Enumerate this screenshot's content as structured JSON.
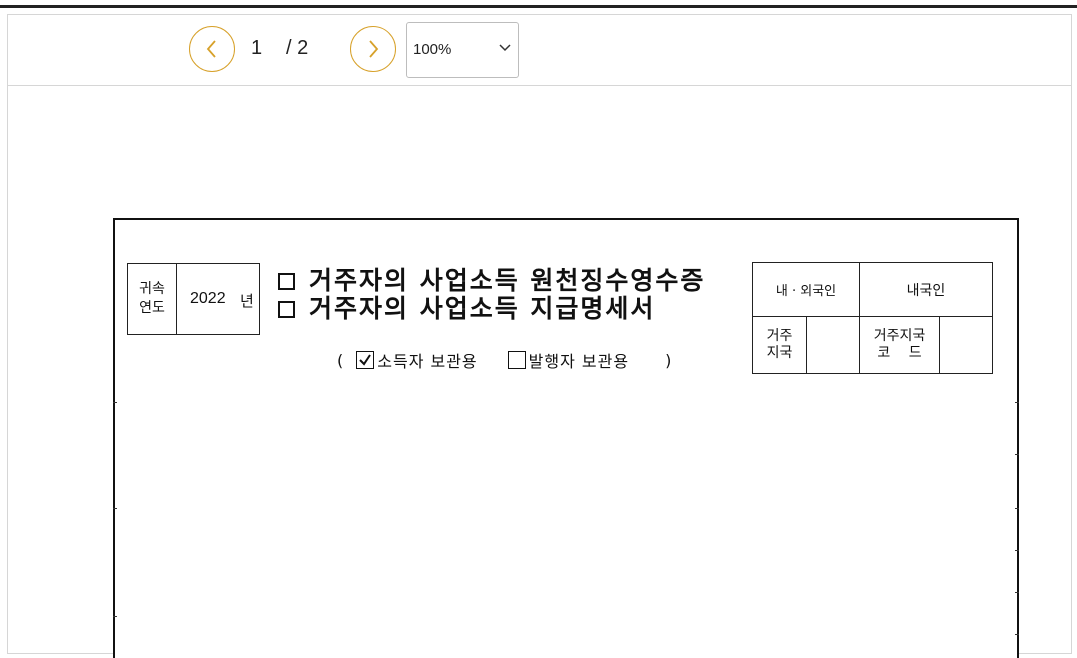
{
  "viewer": {
    "page_current": "1",
    "page_total": "/ 2",
    "zoom": "100%",
    "prev_icon": "chevron-left-icon",
    "next_icon": "chevron-right-icon",
    "accent_color": "#d7a12a"
  },
  "document": {
    "year_label_line1": "귀속",
    "year_label_line2": "연도",
    "year_value": "2022",
    "year_unit": "년",
    "title_line1": "거주자의 사업소득 원천징수영수증",
    "title_line2": "거주자의 사업소득 지급명세서",
    "copy_open": "(",
    "copy_recipient": "소득자 보관용",
    "copy_recipient_checked": true,
    "copy_issuer": "발행자 보관용",
    "copy_issuer_checked": false,
    "copy_close": ")",
    "table": {
      "nationality_label": "내 · 외국인",
      "nationality_value": "내국인",
      "residence_country_line1": "거주",
      "residence_country_line2": "지국",
      "residence_country_value": "",
      "country_code_line1": "거주지국",
      "country_code_line2": "코　 드",
      "country_code_value": ""
    }
  }
}
